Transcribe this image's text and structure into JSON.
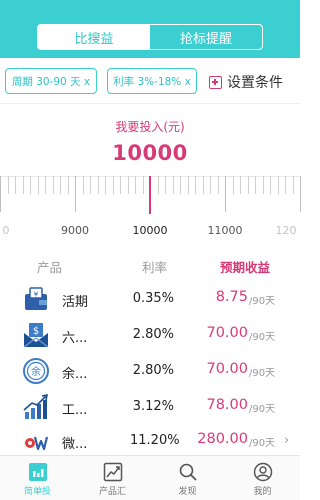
{
  "header": {
    "segments": [
      {
        "label": "比搜益",
        "active": true
      },
      {
        "label": "抢标提醒",
        "active": false
      }
    ],
    "background": "#3ccfd2"
  },
  "filters": {
    "period_chip": "周期 30-90 天 x",
    "rate_chip": "利率 3%-18% x",
    "settings_label": "设置条件"
  },
  "invest": {
    "label": "我要投入(元)",
    "amount": "10000"
  },
  "ruler": {
    "labels": [
      "9000",
      "10000",
      "11000"
    ],
    "left_partial": "0",
    "right_partial": "120"
  },
  "table": {
    "headers": {
      "product": "产品",
      "rate": "利率",
      "income": "预期收益"
    },
    "rows": [
      {
        "icon": "yen-wallet-icon",
        "name": "活期",
        "rate": "0.35%",
        "income": "8.75",
        "unit": "/90天",
        "chevron": false
      },
      {
        "icon": "dollar-envelope-icon",
        "name": "六...",
        "rate": "2.80%",
        "income": "70.00",
        "unit": "/90天",
        "chevron": false
      },
      {
        "icon": "yuebao-icon",
        "name": "余...",
        "rate": "2.80%",
        "income": "70.00",
        "unit": "/90天",
        "chevron": false
      },
      {
        "icon": "growth-chart-icon",
        "name": "工...",
        "rate": "3.12%",
        "income": "78.00",
        "unit": "/90天",
        "chevron": false
      },
      {
        "icon": "weixin-icon",
        "name": "微...",
        "rate": "11.20%",
        "income": "280.00",
        "unit": "/90天",
        "chevron": true
      }
    ]
  },
  "nav": {
    "items": [
      {
        "label": "简单投",
        "icon": "chart-box-icon",
        "active": true
      },
      {
        "label": "产品汇",
        "icon": "trend-chart-icon",
        "active": false
      },
      {
        "label": "发现",
        "icon": "search-icon",
        "active": false
      },
      {
        "label": "我的",
        "icon": "user-icon",
        "active": false
      }
    ]
  },
  "colors": {
    "accent": "#3ccfd2",
    "highlight": "#d73b77"
  }
}
